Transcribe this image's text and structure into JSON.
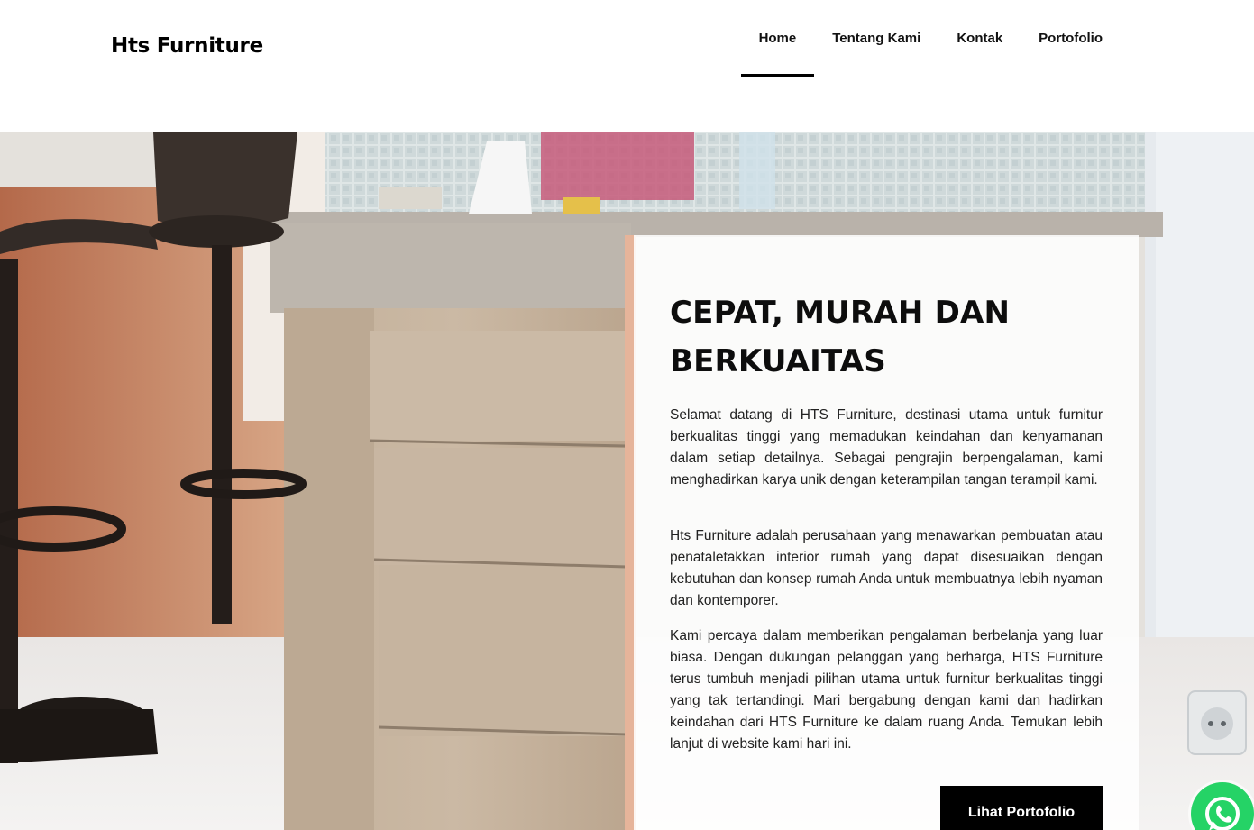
{
  "header": {
    "brand": "Hts Furniture",
    "nav": [
      {
        "label": "Home",
        "active": true
      },
      {
        "label": "Tentang Kami",
        "active": false
      },
      {
        "label": "Kontak",
        "active": false
      },
      {
        "label": "Portofolio",
        "active": false
      }
    ]
  },
  "hero": {
    "title": "CEPAT, MURAH DAN BERKUAITAS",
    "paragraphs": [
      "Selamat datang di HTS Furniture, destinasi utama untuk furnitur berkualitas tinggi yang memadukan keindahan dan kenyamanan dalam setiap detailnya. Sebagai pengrajin berpengalaman, kami menghadirkan karya unik dengan keterampilan tangan terampil kami.",
      "Hts Furniture adalah perusahaan yang menawarkan pembuatan atau penataletakkan interior rumah yang dapat disesuaikan dengan kebutuhan dan konsep rumah Anda untuk membuatnya lebih nyaman dan kontemporer.",
      "Kami percaya dalam memberikan pengalaman berbelanja yang luar biasa. Dengan dukungan pelanggan yang berharga, HTS Furniture terus tumbuh menjadi pilihan utama untuk furnitur berkualitas tinggi yang tak tertandingi. Mari bergabung dengan kami dan hadirkan keindahan dari HTS Furniture ke dalam ruang Anda. Temukan lebih lanjut di website kami hari ini."
    ],
    "cta_label": "Lihat Portofolio"
  },
  "icons": {
    "whatsapp": "whatsapp-icon"
  },
  "colors": {
    "accent_strip": "#e6b49a",
    "cta_bg": "#000000",
    "whatsapp": "#25d366"
  }
}
